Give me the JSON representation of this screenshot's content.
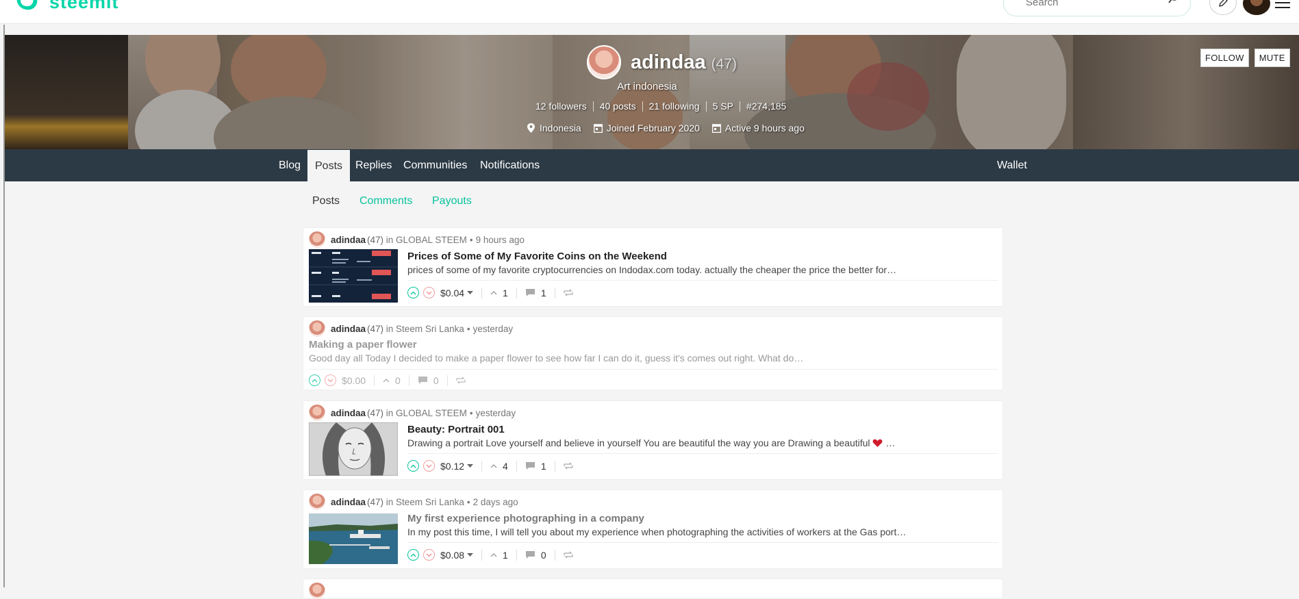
{
  "header": {
    "logo_text": "steemit",
    "search_placeholder": "Search"
  },
  "profile": {
    "name": "adindaa",
    "reputation": "(47)",
    "about": "Art indonesia",
    "stats": [
      "12 followers",
      "40 posts",
      "21 following",
      "5 SP",
      "#274,185"
    ],
    "location": "Indonesia",
    "joined": "Joined February 2020",
    "active": "Active 9 hours ago",
    "follow_label": "FOLLOW",
    "mute_label": "MUTE"
  },
  "nav": {
    "items": [
      "Blog",
      "Posts",
      "Replies",
      "Communities",
      "Notifications"
    ],
    "active": "Posts",
    "wallet": "Wallet"
  },
  "subtabs": {
    "items": [
      "Posts",
      "Comments",
      "Payouts"
    ],
    "active": "Posts"
  },
  "posts": [
    {
      "author": "adindaa",
      "rep": "(47)",
      "community": "in GLOBAL STEEM",
      "time": "9 hours ago",
      "title": "Prices of Some of My Favorite Coins on the Weekend",
      "excerpt": "prices of some of my favorite cryptocurrencies on Indodax.com today. actually the cheaper the price the better for…",
      "payout": "$0.04",
      "votes": "1",
      "comments": "1",
      "thumb": "crypto"
    },
    {
      "author": "adindaa",
      "rep": "(47)",
      "community": "in Steem Sri Lanka",
      "time": "yesterday",
      "title": "Making a paper flower",
      "excerpt": "Good day all Today I decided to make a paper flower to see how far I can do it, guess it's comes out right. What do…",
      "payout": "$0.00",
      "votes": "0",
      "comments": "0",
      "thumb": "none"
    },
    {
      "author": "adindaa",
      "rep": "(47)",
      "community": "in GLOBAL STEEM",
      "time": "yesterday",
      "title": "Beauty: Portrait 001",
      "excerpt": "Drawing a portrait Love yourself and believe in yourself You are beautiful the way you are Drawing a beautiful",
      "excerpt_end": "…",
      "payout": "$0.12",
      "votes": "4",
      "comments": "1",
      "thumb": "portrait"
    },
    {
      "author": "adindaa",
      "rep": "(47)",
      "community": "in Steem Sri Lanka",
      "time": "2 days ago",
      "title": "My first experience photographing in a company",
      "excerpt": "In my post this time, I will tell you about my experience when photographing the activities of workers at the Gas port…",
      "payout": "$0.08",
      "votes": "1",
      "comments": "0",
      "thumb": "port"
    }
  ],
  "crypto_thumb": {
    "rows": [
      {
        "coin": "XRP/idr",
        "price": "5,935",
        "change": "-4.35 %"
      },
      {
        "coin": "BTS/idr",
        "price": "668",
        "change": "-6.27 %"
      },
      {
        "coin": "XLM/idr",
        "price": "4,549",
        "change": "-6.58 %"
      }
    ]
  },
  "colors": {
    "brand": "#06d6a9",
    "nav_bg": "#2c3a45",
    "link": "#06c39c"
  }
}
